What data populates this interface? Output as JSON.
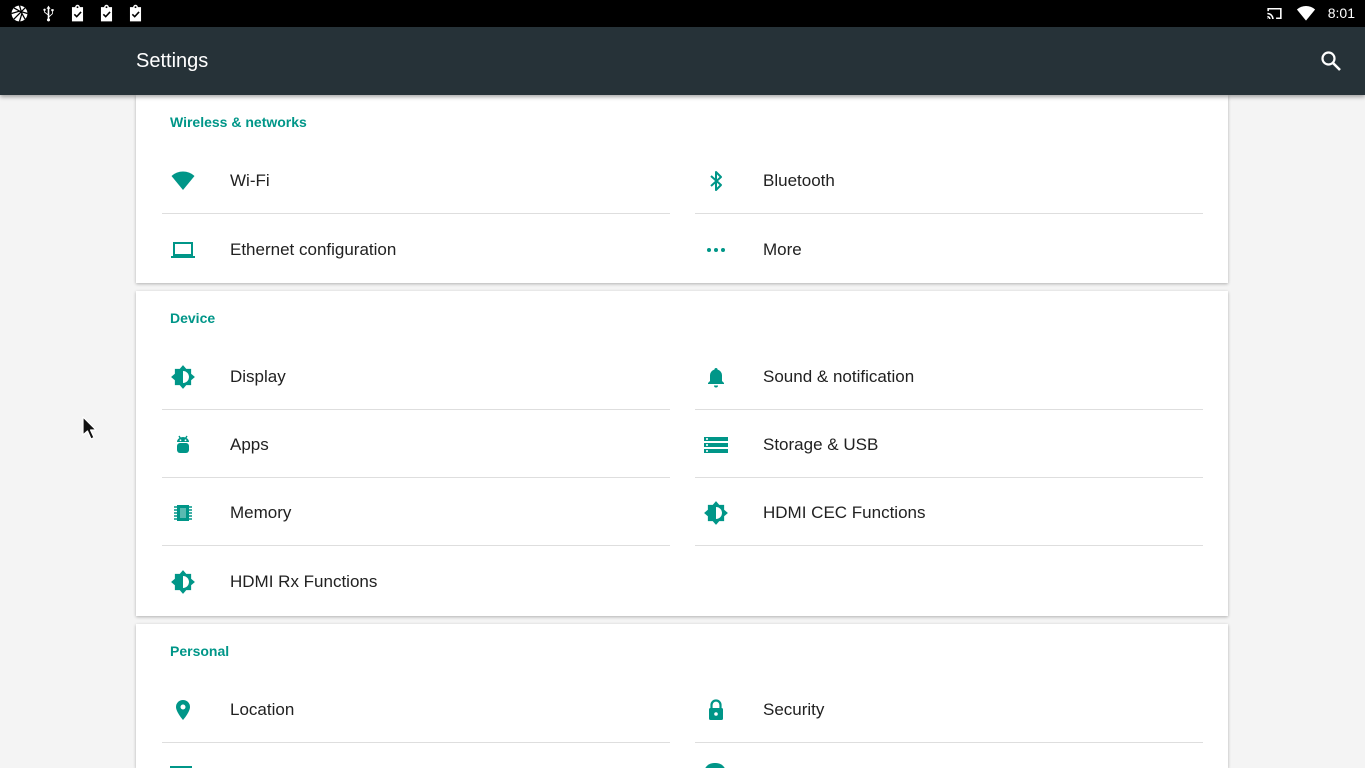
{
  "status_bar": {
    "left_icons": [
      "aperture-icon",
      "usb-icon",
      "clipboard-check-icon",
      "clipboard-check-icon",
      "clipboard-check-icon"
    ],
    "right_icons": [
      "cast-icon",
      "wifi-icon"
    ],
    "time": "8:01"
  },
  "app_bar": {
    "title": "Settings",
    "search_icon": "search-icon"
  },
  "accent_color": "#009688",
  "sections": [
    {
      "title": "Wireless & networks",
      "items": [
        {
          "label": "Wi-Fi",
          "icon": "wifi-icon"
        },
        {
          "label": "Bluetooth",
          "icon": "bluetooth-icon"
        },
        {
          "label": "Ethernet configuration",
          "icon": "laptop-icon"
        },
        {
          "label": "More",
          "icon": "more-dots-icon"
        }
      ]
    },
    {
      "title": "Device",
      "items": [
        {
          "label": "Display",
          "icon": "brightness-icon"
        },
        {
          "label": "Sound & notification",
          "icon": "bell-icon"
        },
        {
          "label": "Apps",
          "icon": "android-icon"
        },
        {
          "label": "Storage & USB",
          "icon": "storage-icon"
        },
        {
          "label": "Memory",
          "icon": "memory-chip-icon"
        },
        {
          "label": "HDMI CEC Functions",
          "icon": "brightness-icon"
        },
        {
          "label": "HDMI Rx Functions",
          "icon": "brightness-icon"
        }
      ]
    },
    {
      "title": "Personal",
      "items": [
        {
          "label": "Location",
          "icon": "location-pin-icon"
        },
        {
          "label": "Security",
          "icon": "lock-icon"
        }
      ]
    }
  ]
}
